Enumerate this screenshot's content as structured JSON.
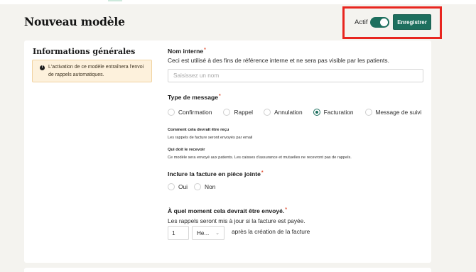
{
  "header": {
    "title": "Nouveau modèle",
    "active_label": "Actif",
    "active_on": true,
    "save_label": "Enregistrer"
  },
  "section": {
    "title": "Informations générales",
    "info_text": "L'activation de ce modèle entraînera l'envoi de rappels automatiques."
  },
  "name_field": {
    "label": "Nom interne",
    "required_mark": "*",
    "help": "Ceci est utilisé à des fins de référence interne et ne sera pas visible par les patients.",
    "placeholder": "Saisissez un nom",
    "value": ""
  },
  "message_type": {
    "label": "Type de message",
    "required_mark": "*",
    "options": [
      {
        "label": "Confirmation",
        "checked": false
      },
      {
        "label": "Rappel",
        "checked": false
      },
      {
        "label": "Annulation",
        "checked": false
      },
      {
        "label": "Facturation",
        "checked": true
      },
      {
        "label": "Message de suivi",
        "checked": false
      }
    ],
    "receipt_title": "Comment cela devrait être reçu",
    "receipt_text": "Les rappels de facture seront envoyés par email",
    "recipient_title": "Qui doit le recevoir",
    "recipient_text": "Ce modèle sera envoyé aux patients. Les caisses d'assurance et mutuelles ne recevront pas de rappels."
  },
  "attach_invoice": {
    "label": "Inclure la facture en pièce jointe",
    "required_mark": "*",
    "options": [
      {
        "label": "Oui",
        "checked": false
      },
      {
        "label": "Non",
        "checked": false
      }
    ]
  },
  "timing": {
    "label": "À quel moment cela devrait être envoyé.",
    "required_mark": "*",
    "help": "Les rappels seront mis à jour si la facture est payée.",
    "quantity": "1",
    "unit": "He...",
    "after_text": "après la création de la facture"
  },
  "colors": {
    "primary": "#1d6f5e",
    "highlight": "#e8251f",
    "info_bg": "#fdf1dc",
    "required": "#e2553a",
    "background": "#f4f3ef"
  },
  "icons": {
    "info": "info-circle-icon",
    "chevron": "chevron-down-icon"
  }
}
